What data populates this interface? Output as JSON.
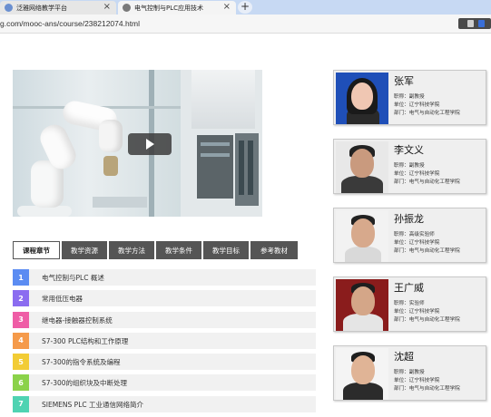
{
  "browser": {
    "tabs": [
      {
        "title": "泛雅网络教学平台",
        "active": false,
        "icon_color": "#6a8fd0"
      },
      {
        "title": "电气控制与PLC应用技术",
        "active": true,
        "icon_color": "#7a7a7a"
      }
    ],
    "url": "g.com/mooc-ans/course/238212074.html",
    "close_glyph": "×",
    "new_tab_glyph": "+"
  },
  "video": {
    "play_icon": "play-icon"
  },
  "course_tabs": [
    "课程章节",
    "教学资源",
    "教学方法",
    "教学条件",
    "教学目标",
    "参考教材"
  ],
  "chapters": [
    {
      "num": "1",
      "title": "电气控制与PLC 概述",
      "color": "#5b8cf2"
    },
    {
      "num": "2",
      "title": "常用低压电器",
      "color": "#8b6cf0"
    },
    {
      "num": "3",
      "title": "继电器-接触器控制系统",
      "color": "#ef5da6"
    },
    {
      "num": "4",
      "title": "S7-300 PLC结构和工作原理",
      "color": "#f59a4a"
    },
    {
      "num": "5",
      "title": "S7-300的指令系统及编程",
      "color": "#f2cc35"
    },
    {
      "num": "6",
      "title": "S7-300的组织块及中断处理",
      "color": "#8bd24a"
    },
    {
      "num": "7",
      "title": "SIEMENS PLC 工业通信网络简介",
      "color": "#4fd3b2"
    }
  ],
  "teachers": [
    {
      "name": "张军",
      "title_line": "职称：副教授",
      "unit_line": "单位：辽宁科技学院",
      "dept_line": "部门：电气与自动化工程学院"
    },
    {
      "name": "李文义",
      "title_line": "职称：副教授",
      "unit_line": "单位：辽宁科技学院",
      "dept_line": "部门：电气与自动化工程学院"
    },
    {
      "name": "孙振龙",
      "title_line": "职称：高级实验师",
      "unit_line": "单位：辽宁科技学院",
      "dept_line": "部门：电气与自动化工程学院"
    },
    {
      "name": "王广威",
      "title_line": "职称：实验师",
      "unit_line": "单位：辽宁科技学院",
      "dept_line": "部门：电气与自动化工程学院"
    },
    {
      "name": "沈超",
      "title_line": "职称：副教授",
      "unit_line": "单位：辽宁科技学院",
      "dept_line": "部门：电气与自动化工程学院"
    }
  ]
}
